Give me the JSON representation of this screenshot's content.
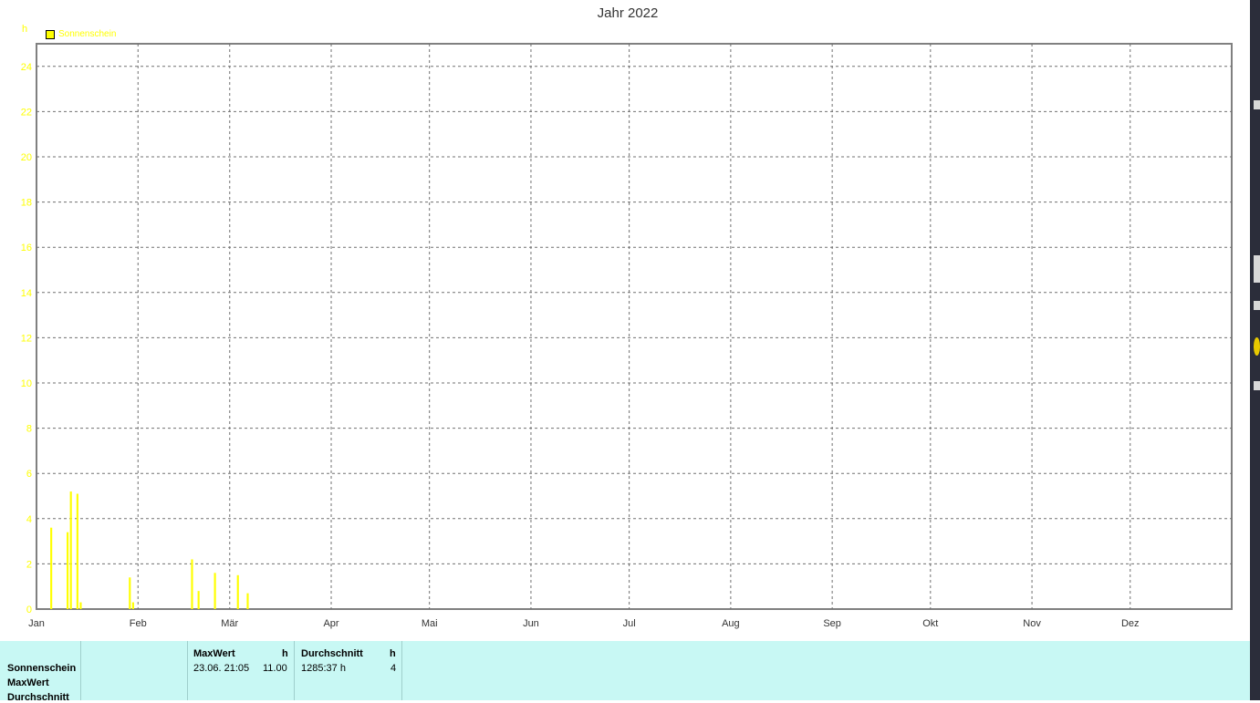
{
  "chart_data": {
    "type": "bar",
    "title": "Jahr 2022",
    "ylabel": "h",
    "ylim": [
      0,
      25
    ],
    "yticks": [
      "0",
      "2",
      "4",
      "6",
      "8",
      "10",
      "12",
      "14",
      "16",
      "18",
      "20",
      "22",
      "24"
    ],
    "xlim": [
      0,
      365
    ],
    "xtick_labels": [
      "Jan",
      "Feb",
      "Mär",
      "Apr",
      "Mai",
      "Jun",
      "Jul",
      "Aug",
      "Sep",
      "Okt",
      "Nov",
      "Dez"
    ],
    "xtick_days": [
      0,
      31,
      59,
      90,
      120,
      151,
      181,
      212,
      243,
      273,
      304,
      334
    ],
    "grid": true,
    "legend_position": "top-left",
    "series": [
      {
        "name": "Sonnenschein",
        "color": "#ffff00",
        "values": [
          0,
          0,
          0,
          0,
          3.6,
          0,
          0,
          0,
          0,
          3.4,
          5.2,
          0,
          5.1,
          0.3,
          0,
          0,
          0,
          0,
          0,
          0,
          0,
          0,
          0,
          0,
          0,
          0,
          0,
          0,
          1.4,
          0.3,
          0,
          0,
          0,
          0,
          0,
          0,
          0,
          0,
          0,
          0,
          0,
          0,
          0,
          0,
          0,
          0,
          0,
          2.2,
          0,
          0.8,
          0,
          0,
          0,
          0,
          1.6,
          0,
          0,
          0,
          0,
          0,
          0,
          1.5,
          0,
          0,
          0.7,
          0,
          0,
          0,
          0,
          0,
          0,
          0,
          0,
          0,
          0,
          0,
          0,
          0,
          0,
          0,
          0,
          0,
          0,
          0,
          0,
          0,
          0,
          0,
          0,
          0,
          0,
          0,
          0,
          0,
          0,
          0,
          0,
          0,
          0,
          0,
          0,
          0,
          0,
          0,
          0,
          0,
          0,
          0,
          0,
          0,
          0,
          0,
          0,
          0,
          0,
          0,
          0,
          0,
          0,
          0,
          0,
          0,
          0,
          0,
          0,
          0,
          0,
          0,
          0,
          0,
          0,
          0,
          0,
          0,
          0,
          0,
          0,
          0,
          0,
          0,
          0,
          0,
          0,
          0,
          0,
          0,
          0,
          0,
          0,
          0,
          0,
          0,
          0,
          0,
          0,
          0,
          0,
          0,
          0,
          0,
          0,
          0,
          0,
          0,
          0,
          0,
          0,
          0,
          0,
          0,
          0,
          0,
          0,
          0,
          0,
          0,
          0,
          0,
          0,
          0,
          0,
          0,
          0,
          0,
          0,
          0,
          0,
          0,
          0,
          0,
          0,
          0,
          0,
          0,
          0,
          0,
          0,
          0,
          0,
          0,
          0,
          0,
          0,
          0,
          0,
          0,
          0,
          0,
          0,
          0,
          0,
          0,
          0,
          0,
          0,
          0,
          0,
          0,
          0,
          0,
          0,
          0,
          0,
          0,
          0,
          0,
          0,
          0,
          0,
          0,
          0,
          0,
          0,
          0,
          0,
          0,
          0,
          0,
          0,
          0,
          0,
          0,
          0,
          0,
          0,
          0,
          0,
          0,
          0,
          0,
          0,
          0,
          0,
          0,
          0,
          0,
          0,
          0,
          0,
          0,
          0,
          0,
          0,
          0,
          0,
          0,
          0,
          0,
          0,
          0,
          0,
          0,
          0,
          0,
          0,
          0,
          0,
          0,
          0,
          0,
          0,
          0,
          0,
          0,
          0,
          0,
          0,
          0,
          0,
          0,
          0,
          0,
          0,
          0,
          0,
          0,
          0,
          0,
          0,
          0,
          0,
          0,
          0,
          0,
          0,
          0,
          0,
          0,
          0,
          0,
          0,
          0,
          0,
          0,
          0,
          0,
          0,
          0,
          0,
          0,
          0,
          0,
          0,
          0,
          0,
          0,
          0,
          0,
          0,
          0,
          0,
          0,
          0,
          0,
          0,
          0,
          0,
          0,
          0,
          0,
          0,
          0,
          0,
          0,
          0,
          0,
          0,
          0,
          0,
          0,
          0,
          0,
          0,
          0,
          0,
          0,
          0,
          0,
          0,
          0,
          0,
          0,
          0,
          0,
          0,
          0,
          0,
          0,
          0,
          0,
          0,
          0,
          0,
          0,
          0,
          0,
          0,
          0,
          0,
          0,
          0,
          0,
          0,
          0,
          0,
          0,
          0,
          0,
          0,
          0,
          0,
          0,
          0,
          0,
          0,
          0,
          0,
          0,
          0,
          0,
          0,
          0,
          0,
          0,
          0,
          0
        ]
      }
    ]
  },
  "stats": {
    "row_labels": [
      "Sonnenschein",
      "MaxWert",
      "Durchschnitt"
    ],
    "max_header": "MaxWert",
    "max_unit": "h",
    "max_date": "23.06.  21:05",
    "max_value": "11.00",
    "avg_header": "Durchschnitt",
    "avg_unit": "h",
    "avg_total": "1285:37 h",
    "avg_value": "4"
  }
}
